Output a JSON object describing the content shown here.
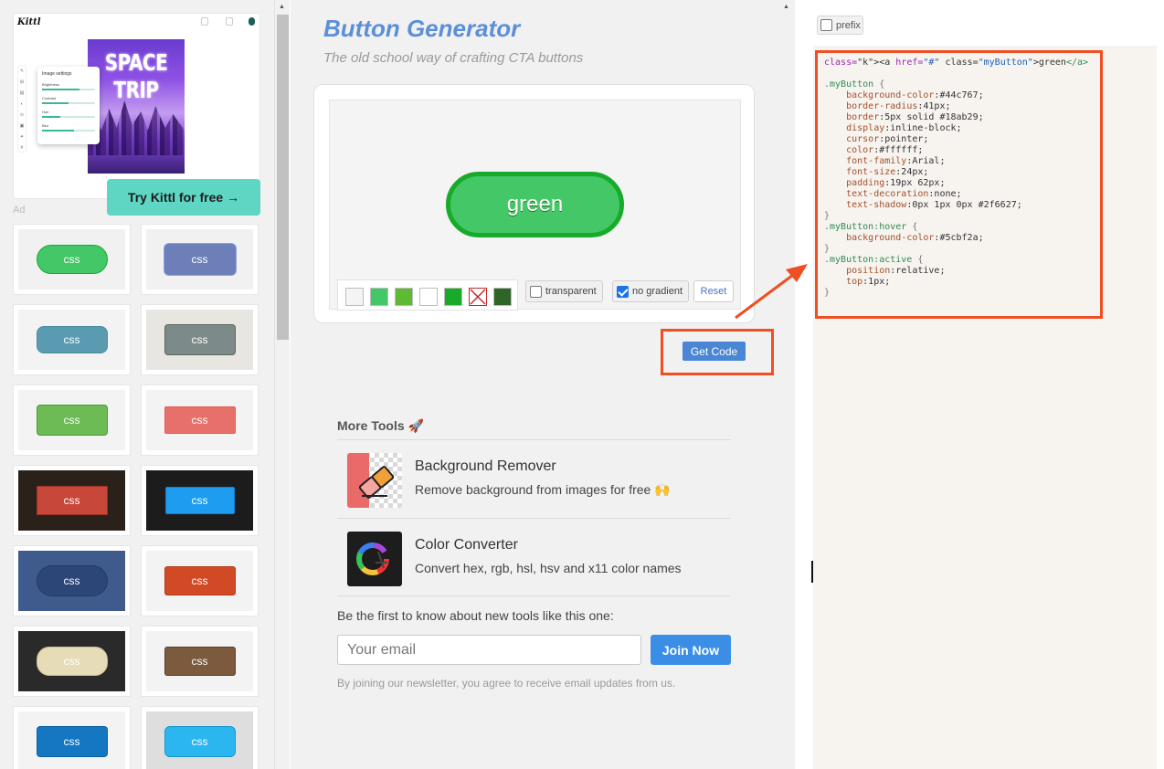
{
  "ad": {
    "logo": "Kittl",
    "poster_title": "SPACE TRIP",
    "panel_title": "Image settings",
    "sliders": [
      {
        "label": "Brightness",
        "value": 0.7
      },
      {
        "label": "Contrast",
        "value": 0.5
      },
      {
        "label": "Hue",
        "value": 0.35
      },
      {
        "label": "Blur",
        "value": 0.6
      }
    ],
    "cta": "Try Kittl for free →",
    "label": "Ad"
  },
  "gallery": {
    "button_label": "css",
    "items": [
      {
        "bg": "#f1f1f1",
        "btn": "#44c767",
        "border": "#18ab29",
        "radius": "28px",
        "w": 78,
        "h": 32
      },
      {
        "bg": "#f1f1f1",
        "btn": "#6c7fb8",
        "border": "#8fa0e6",
        "radius": "6px",
        "w": 80,
        "h": 36
      },
      {
        "bg": "#f3f3f3",
        "btn": "#5b9bb1",
        "border": "#4b8aa0",
        "radius": "8px",
        "w": 78,
        "h": 30
      },
      {
        "bg": "#e7e6e0",
        "btn": "#7c8b89",
        "border": "#59665f",
        "radius": "4px",
        "w": 78,
        "h": 34
      },
      {
        "bg": "#f3f3f3",
        "btn": "#6dbb54",
        "border": "#4b9a3a",
        "radius": "4px",
        "w": 78,
        "h": 34
      },
      {
        "bg": "#f3f3f3",
        "btn": "#e8706a",
        "border": "#e05c55",
        "radius": "2px",
        "w": 78,
        "h": 30
      },
      {
        "bg": "#2b211b",
        "btn": "#c7473a",
        "border": "#9b3326",
        "radius": "0px",
        "w": 78,
        "h": 32
      },
      {
        "bg": "#1c1c1c",
        "btn": "#1e9cf0",
        "border": "#137ed0",
        "radius": "2px",
        "w": 76,
        "h": 30
      },
      {
        "bg": "#3f5b8e",
        "btn": "#2d4678",
        "border": "#233966",
        "radius": "18px",
        "w": 78,
        "h": 34
      },
      {
        "bg": "#f3f3f3",
        "btn": "#d24a25",
        "border": "#b53b17",
        "radius": "3px",
        "w": 78,
        "h": 32
      },
      {
        "bg": "#2a2a2a",
        "btn": "#e6dcb8",
        "border": "#cabd91",
        "radius": "14px",
        "w": 78,
        "h": 32
      },
      {
        "bg": "#f3f3f3",
        "btn": "#7b5a3d",
        "border": "#5e4128",
        "radius": "3px",
        "w": 78,
        "h": 32
      },
      {
        "bg": "#f3f3f3",
        "btn": "#1577c1",
        "border": "#0d5f9e",
        "radius": "4px",
        "w": 78,
        "h": 34
      },
      {
        "bg": "#dedede",
        "btn": "#2cb6ef",
        "border": "#1797cf",
        "radius": "6px",
        "w": 78,
        "h": 34
      }
    ]
  },
  "header": {
    "title": "Button Generator",
    "subtitle": "The old school way of crafting CTA buttons"
  },
  "preview": {
    "button_text": "green",
    "swatches": [
      "#f4f4f4",
      "#44c767",
      "#5dbb33",
      "#ffffff",
      "#18ab29",
      "none",
      "#2f6627"
    ],
    "transparent_label": "transparent",
    "transparent_checked": false,
    "no_gradient_label": "no gradient",
    "no_gradient_checked": true,
    "reset_label": "Reset",
    "get_code_label": "Get Code"
  },
  "tools": {
    "heading": "More Tools 🚀",
    "items": [
      {
        "name": "Background Remover",
        "desc": "Remove background from images for free 🙌"
      },
      {
        "name": "Color Converter",
        "desc": "Convert hex, rgb, hsl, hsv and x11 color names"
      }
    ]
  },
  "newsletter": {
    "text": "Be the first to know about new tools like this one:",
    "placeholder": "Your email",
    "join_label": "Join Now",
    "disclaimer": "By joining our newsletter, you agree to receive email updates from us."
  },
  "code": {
    "prefix_label": "prefix",
    "lines": [
      "<a href=\"#\" class=\"myButton\">green</a>",
      "",
      ".myButton {",
      "    background-color:#44c767;",
      "    border-radius:41px;",
      "    border:5px solid #18ab29;",
      "    display:inline-block;",
      "    cursor:pointer;",
      "    color:#ffffff;",
      "    font-family:Arial;",
      "    font-size:24px;",
      "    padding:19px 62px;",
      "    text-decoration:none;",
      "    text-shadow:0px 1px 0px #2f6627;",
      "}",
      ".myButton:hover {",
      "    background-color:#5cbf2a;",
      "}",
      ".myButton:active {",
      "    position:relative;",
      "    top:1px;",
      "}"
    ]
  },
  "colors": {
    "accent": "#5b8fd9",
    "highlight": "#f04e23",
    "join": "#3a8ee6"
  }
}
